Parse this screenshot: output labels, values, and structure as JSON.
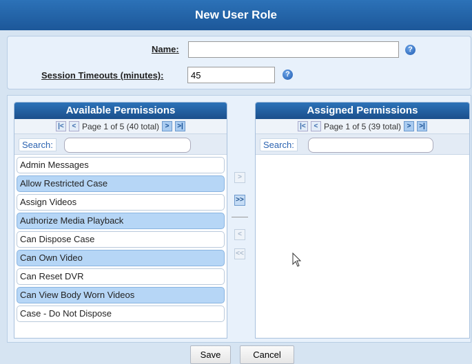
{
  "dialog": {
    "title": "New User Role"
  },
  "form": {
    "name_label": "Name:",
    "name_value": "",
    "timeout_label": "Session Timeouts (minutes):",
    "timeout_value": "45",
    "help_icon": "help-icon"
  },
  "available": {
    "title": "Available Permissions",
    "page_info": "Page 1 of 5 (40 total)",
    "search_label": "Search:",
    "search_value": "",
    "items": [
      {
        "label": "Admin Messages",
        "selected": false
      },
      {
        "label": "Allow Restricted Case",
        "selected": true
      },
      {
        "label": "Assign Videos",
        "selected": false
      },
      {
        "label": "Authorize Media Playback",
        "selected": true
      },
      {
        "label": "Can Dispose Case",
        "selected": false
      },
      {
        "label": "Can Own Video",
        "selected": true
      },
      {
        "label": "Can Reset DVR",
        "selected": false
      },
      {
        "label": "Can View Body Worn Videos",
        "selected": true
      },
      {
        "label": "Case - Do Not Dispose",
        "selected": false
      }
    ]
  },
  "assigned": {
    "title": "Assigned Permissions",
    "page_info": "Page 1 of 5 (39 total)",
    "search_label": "Search:",
    "search_value": "",
    "items": []
  },
  "move_buttons": {
    "add": ">",
    "add_all": ">>",
    "remove": "<",
    "remove_all": "<<"
  },
  "pager_buttons": {
    "first": "|<",
    "prev": "<",
    "next": ">",
    "last": ">|"
  },
  "footer": {
    "save_label": "Save",
    "cancel_label": "Cancel"
  },
  "colors": {
    "header": "#1c5799",
    "selected_row": "#b6d6f6",
    "background": "#d6e4f2"
  }
}
